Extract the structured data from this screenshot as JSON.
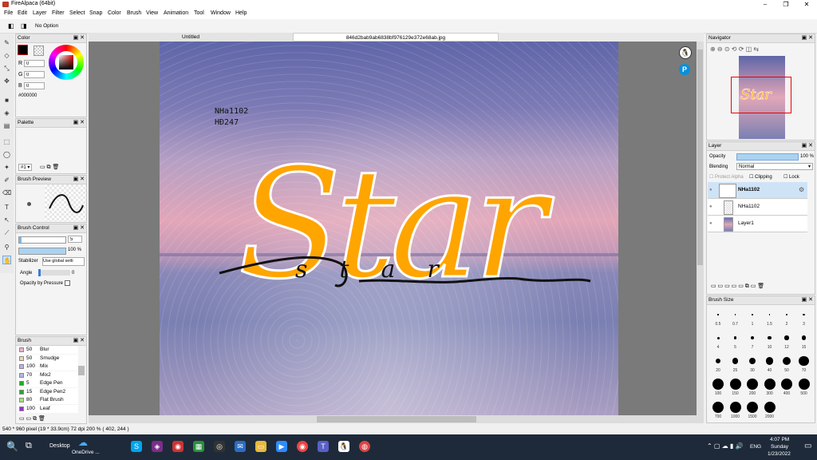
{
  "window": {
    "title": "FireAlpaca (64bit)",
    "minimize": "–",
    "maximize": "❐",
    "close": "✕"
  },
  "menu": [
    "File",
    "Edit",
    "Layer",
    "Filter",
    "Select",
    "Snap",
    "Color",
    "Brush",
    "View",
    "Animation",
    "Tool",
    "Window",
    "Help"
  ],
  "tool_options": {
    "label": "No Option"
  },
  "tabs": [
    {
      "label": "Untitled"
    },
    {
      "label": "846d2bab9ab6838bf976129e372e68ab.jpg"
    }
  ],
  "color_panel": {
    "title": "Color",
    "r_label": "R",
    "r": "0",
    "g_label": "G",
    "g": "0",
    "b_label": "B",
    "b": "0",
    "hex": "#000000"
  },
  "palette_panel": {
    "title": "Palette",
    "selector": "#1"
  },
  "brush_preview": {
    "title": "Brush Preview"
  },
  "brush_control": {
    "title": "Brush Control",
    "size": "5",
    "opacity": "100 %",
    "stabilizer_label": "Stabilizer",
    "stabilizer_value": "Use global setti",
    "angle_label": "Angle",
    "angle_value": "0",
    "opacity_pressure_label": "Opacity by Pressure"
  },
  "brush_panel": {
    "title": "Brush",
    "items": [
      {
        "size": "50",
        "name": "Blur",
        "color": "#e8b4d0"
      },
      {
        "size": "50",
        "name": "Smudge",
        "color": "#f3d4a8"
      },
      {
        "size": "100",
        "name": "Mix",
        "color": "#b9b3e8"
      },
      {
        "size": "70",
        "name": "Mix2",
        "color": "#b9b3e8"
      },
      {
        "size": "5",
        "name": "Edge Pen",
        "color": "#22aa22"
      },
      {
        "size": "15",
        "name": "Edge Pen2",
        "color": "#22aa22"
      },
      {
        "size": "80",
        "name": "Flat Brush",
        "color": "#a8e07a"
      },
      {
        "size": "100",
        "name": "Leaf",
        "color": "#9a2bd6"
      }
    ]
  },
  "artwork": {
    "caption_line1": "NHa1102",
    "caption_line2": "HĐ247",
    "big_word": "Star",
    "script_word": "star"
  },
  "navigator": {
    "title": "Navigator"
  },
  "layer_panel": {
    "title": "Layer",
    "opacity_label": "Opacity",
    "opacity_value": "100 %",
    "blending_label": "Blending",
    "blending_value": "Normal",
    "protect_alpha": "Protect Alpha",
    "clipping": "Clipping",
    "lock": "Lock",
    "layers": [
      {
        "name": "NHa1102",
        "selected": true
      },
      {
        "name": "NHa1102",
        "selected": false
      },
      {
        "name": "Layer1",
        "selected": false
      }
    ]
  },
  "brush_size_panel": {
    "title": "Brush Size",
    "sizes": [
      "0.5",
      "0.7",
      "1",
      "1.5",
      "2",
      "3",
      "4",
      "5",
      "7",
      "10",
      "12",
      "15",
      "20",
      "25",
      "30",
      "40",
      "50",
      "70",
      "100",
      "150",
      "200",
      "300",
      "400",
      "500",
      "700",
      "1000",
      "1500",
      "2000"
    ]
  },
  "status": {
    "text": "540 * 960 pixel  (19 * 33.9cm)  72 dpi  200 %  ( 402, 244 )"
  },
  "taskbar": {
    "desktop": "Desktop",
    "onedrive": "OneDrive ...",
    "time": "4:07 PM",
    "day": "Sunday",
    "date": "1/23/2022",
    "lang": "ENG"
  },
  "colors": {
    "accent": "#0078d7",
    "star_fill": "#ffa500",
    "selection": "#cfe3f7"
  }
}
